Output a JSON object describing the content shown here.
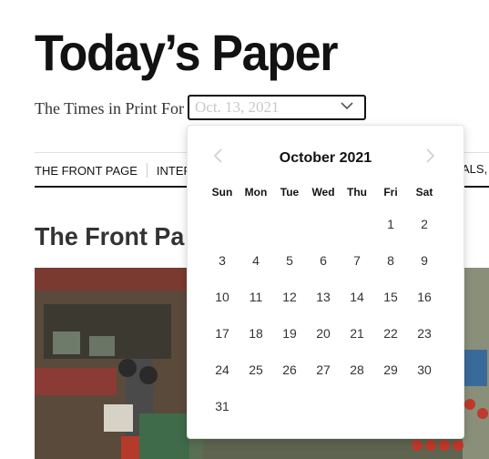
{
  "header": {
    "title": "Today’s Paper",
    "print_label": "The Times in Print For",
    "date_placeholder": "Oct. 13, 2021"
  },
  "nav": {
    "items": [
      "THE FRONT PAGE",
      "INTERN"
    ],
    "last_fragment": "ALS,"
  },
  "section": {
    "title": "The Front Pa"
  },
  "calendar": {
    "month_label": "October 2021",
    "weekdays": [
      "Sun",
      "Mon",
      "Tue",
      "Wed",
      "Thu",
      "Fri",
      "Sat"
    ],
    "first_weekday_index": 5,
    "days": [
      "1",
      "2",
      "3",
      "4",
      "5",
      "6",
      "7",
      "8",
      "9",
      "10",
      "11",
      "12",
      "13",
      "14",
      "15",
      "16",
      "17",
      "18",
      "19",
      "20",
      "21",
      "22",
      "23",
      "24",
      "25",
      "26",
      "27",
      "28",
      "29",
      "30",
      "31"
    ]
  },
  "colors": {
    "text": "#121212",
    "placeholder": "#c9c9c9",
    "disabled_chevron": "#cfcfcf"
  },
  "icons": {
    "prev": "chevron-left-icon",
    "next": "chevron-right-icon",
    "dropdown": "chevron-down-icon"
  }
}
